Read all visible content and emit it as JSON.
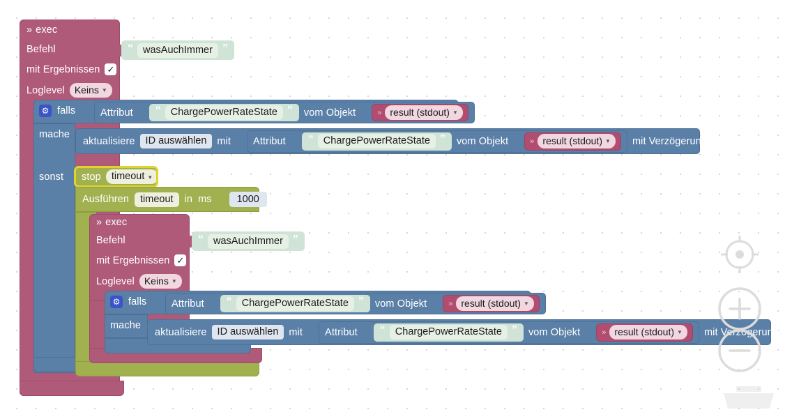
{
  "workspace": {
    "name": "blockly-workspace",
    "grid": "dotted",
    "colors": {
      "exec_block": "#b05a7a",
      "logic_block": "#5b80a8",
      "timeout_block": "#a2b14f",
      "string_block": "#cfe3d6",
      "value_block": "#b24d72",
      "selection_highlight": "#e0d32f",
      "background": "#ffffff"
    }
  },
  "outer_exec": {
    "title": "exec",
    "title_prefix": "»",
    "fields": [
      {
        "label": "Befehl",
        "value": "wasAuchImmer",
        "type": "string"
      },
      {
        "label": "mit Ergebnissen",
        "value": "✓",
        "type": "checkbox"
      },
      {
        "label": "Loglevel",
        "value": "Keins",
        "type": "dropdown"
      }
    ]
  },
  "outer_if": {
    "keyword": "falls",
    "do_keyword": "mache",
    "else_keyword": "sonst",
    "condition": {
      "attribute_label": "Attribut",
      "attribute_name": "ChargePowerRateState",
      "object_label": "vom Objekt",
      "object_value": "result (stdout)"
    },
    "do_statement": {
      "update_label": "aktualisiere",
      "target": "ID auswählen",
      "with_label": "mit",
      "attribute_label": "Attribut",
      "attribute_name": "ChargePowerRateState",
      "object_label": "vom Objekt",
      "object_value": "result (stdout)",
      "delay_label": "mit Verzögerung",
      "delay_checked": false
    }
  },
  "stop_timeout": {
    "action": "stop",
    "name": "timeout",
    "selected": true
  },
  "run_timeout": {
    "action": "Ausführen",
    "name": "timeout",
    "in_label": "in",
    "unit_label": "ms",
    "value": "1000"
  },
  "inner_exec": {
    "title": "exec",
    "title_prefix": "»",
    "fields": [
      {
        "label": "Befehl",
        "value": "wasAuchImmer",
        "type": "string"
      },
      {
        "label": "mit Ergebnissen",
        "value": "✓",
        "type": "checkbox"
      },
      {
        "label": "Loglevel",
        "value": "Keins",
        "type": "dropdown"
      }
    ]
  },
  "inner_if": {
    "keyword": "falls",
    "do_keyword": "mache",
    "condition": {
      "attribute_label": "Attribut",
      "attribute_name": "ChargePowerRateState",
      "object_label": "vom Objekt",
      "object_value": "result (stdout)"
    },
    "do_statement": {
      "update_label": "aktualisiere",
      "target": "ID auswählen",
      "with_label": "mit",
      "attribute_label": "Attribut",
      "attribute_name": "ChargePowerRateState",
      "object_label": "vom Objekt",
      "object_value": "result (stdout)",
      "delay_label": "mit Verzögerung",
      "delay_checked": false
    }
  },
  "controls": {
    "center_label": "center-on-blocks",
    "zoom_in_label": "zoom-in",
    "zoom_out_label": "zoom-out",
    "trash_label": "trash"
  }
}
